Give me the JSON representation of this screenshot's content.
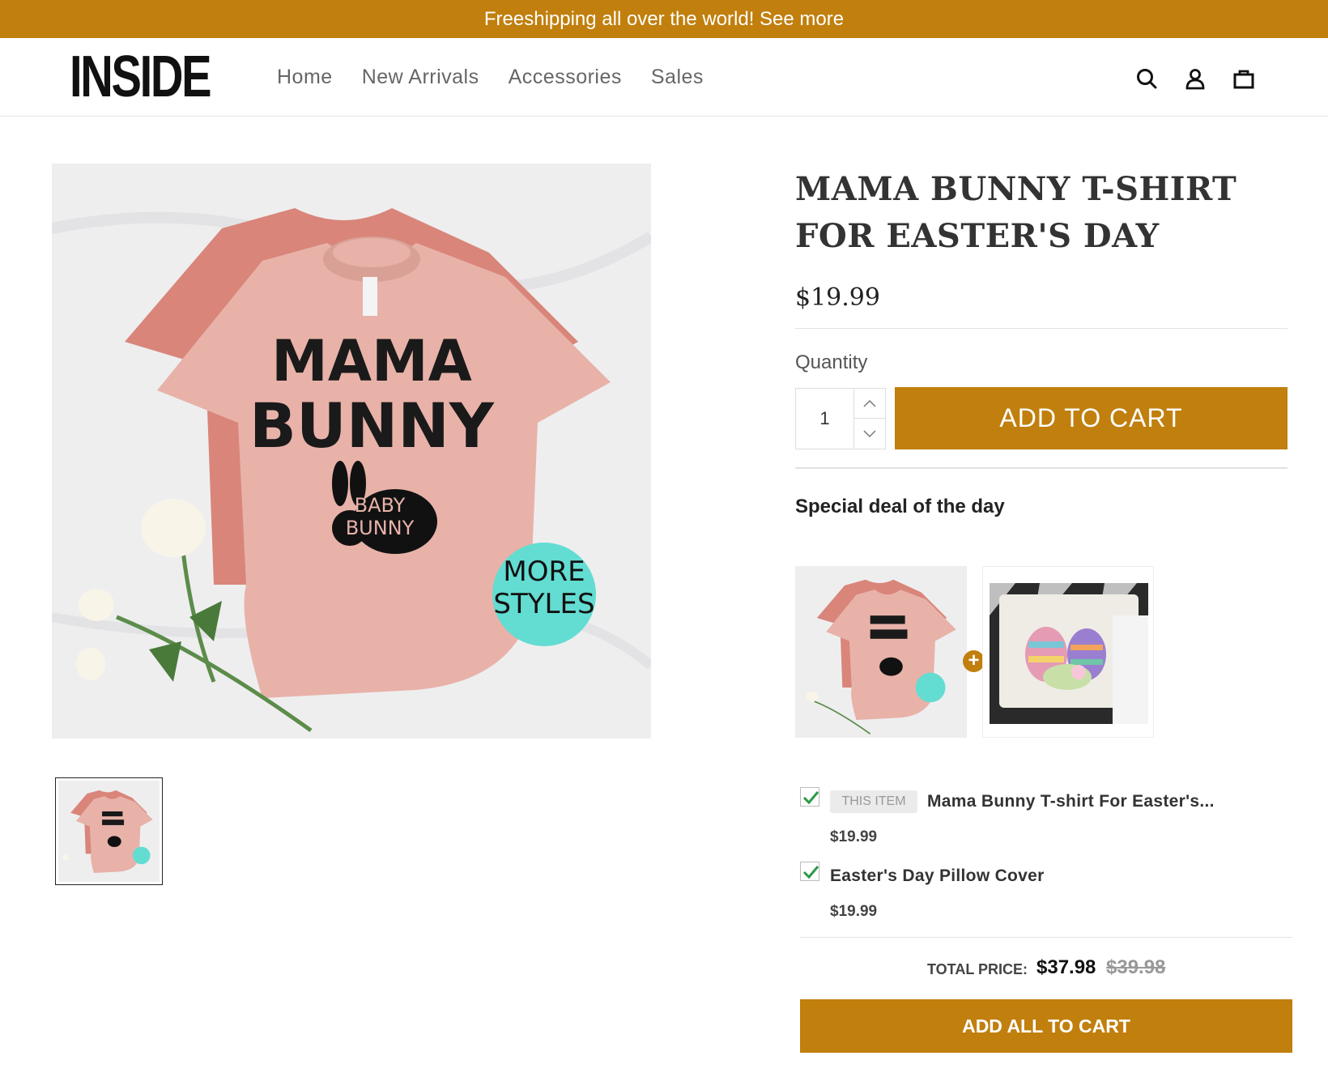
{
  "topbar": {
    "text": "Freeshipping all over the world! See more"
  },
  "header": {
    "logo": "INSIDE",
    "nav": [
      "Home",
      "New Arrivals",
      "Accessories",
      "Sales"
    ],
    "icons": [
      "search-icon",
      "user-icon",
      "bag-icon"
    ]
  },
  "product": {
    "title": "MAMA BUNNY T-SHIRT FOR EASTER'S DAY",
    "price": "$19.99",
    "image_text": {
      "line1": "MAMA",
      "line2": "BUNNY",
      "bunny1": "BABY",
      "bunny2": "BUNNY",
      "badge1": "MORE",
      "badge2": "STYLES"
    },
    "quantity_label": "Quantity",
    "quantity_value": "1",
    "add_to_cart": "ADD TO CART"
  },
  "deal": {
    "title": "Special deal of the day",
    "this_item_badge": "THIS ITEM",
    "items": [
      {
        "name": "Mama Bunny T-shirt For Easter's...",
        "price": "$19.99",
        "checked": true
      },
      {
        "name": "Easter's Day Pillow Cover",
        "price": "$19.99",
        "checked": true
      }
    ],
    "total_label": "TOTAL PRICE:",
    "total_price": "$37.98",
    "total_old_price": "$39.98",
    "add_all": "ADD ALL TO CART"
  },
  "colors": {
    "accent": "#c17f0d",
    "shirt": "#e8b2a9",
    "shirt_back": "#d9857a",
    "teal": "#63dcd2"
  }
}
